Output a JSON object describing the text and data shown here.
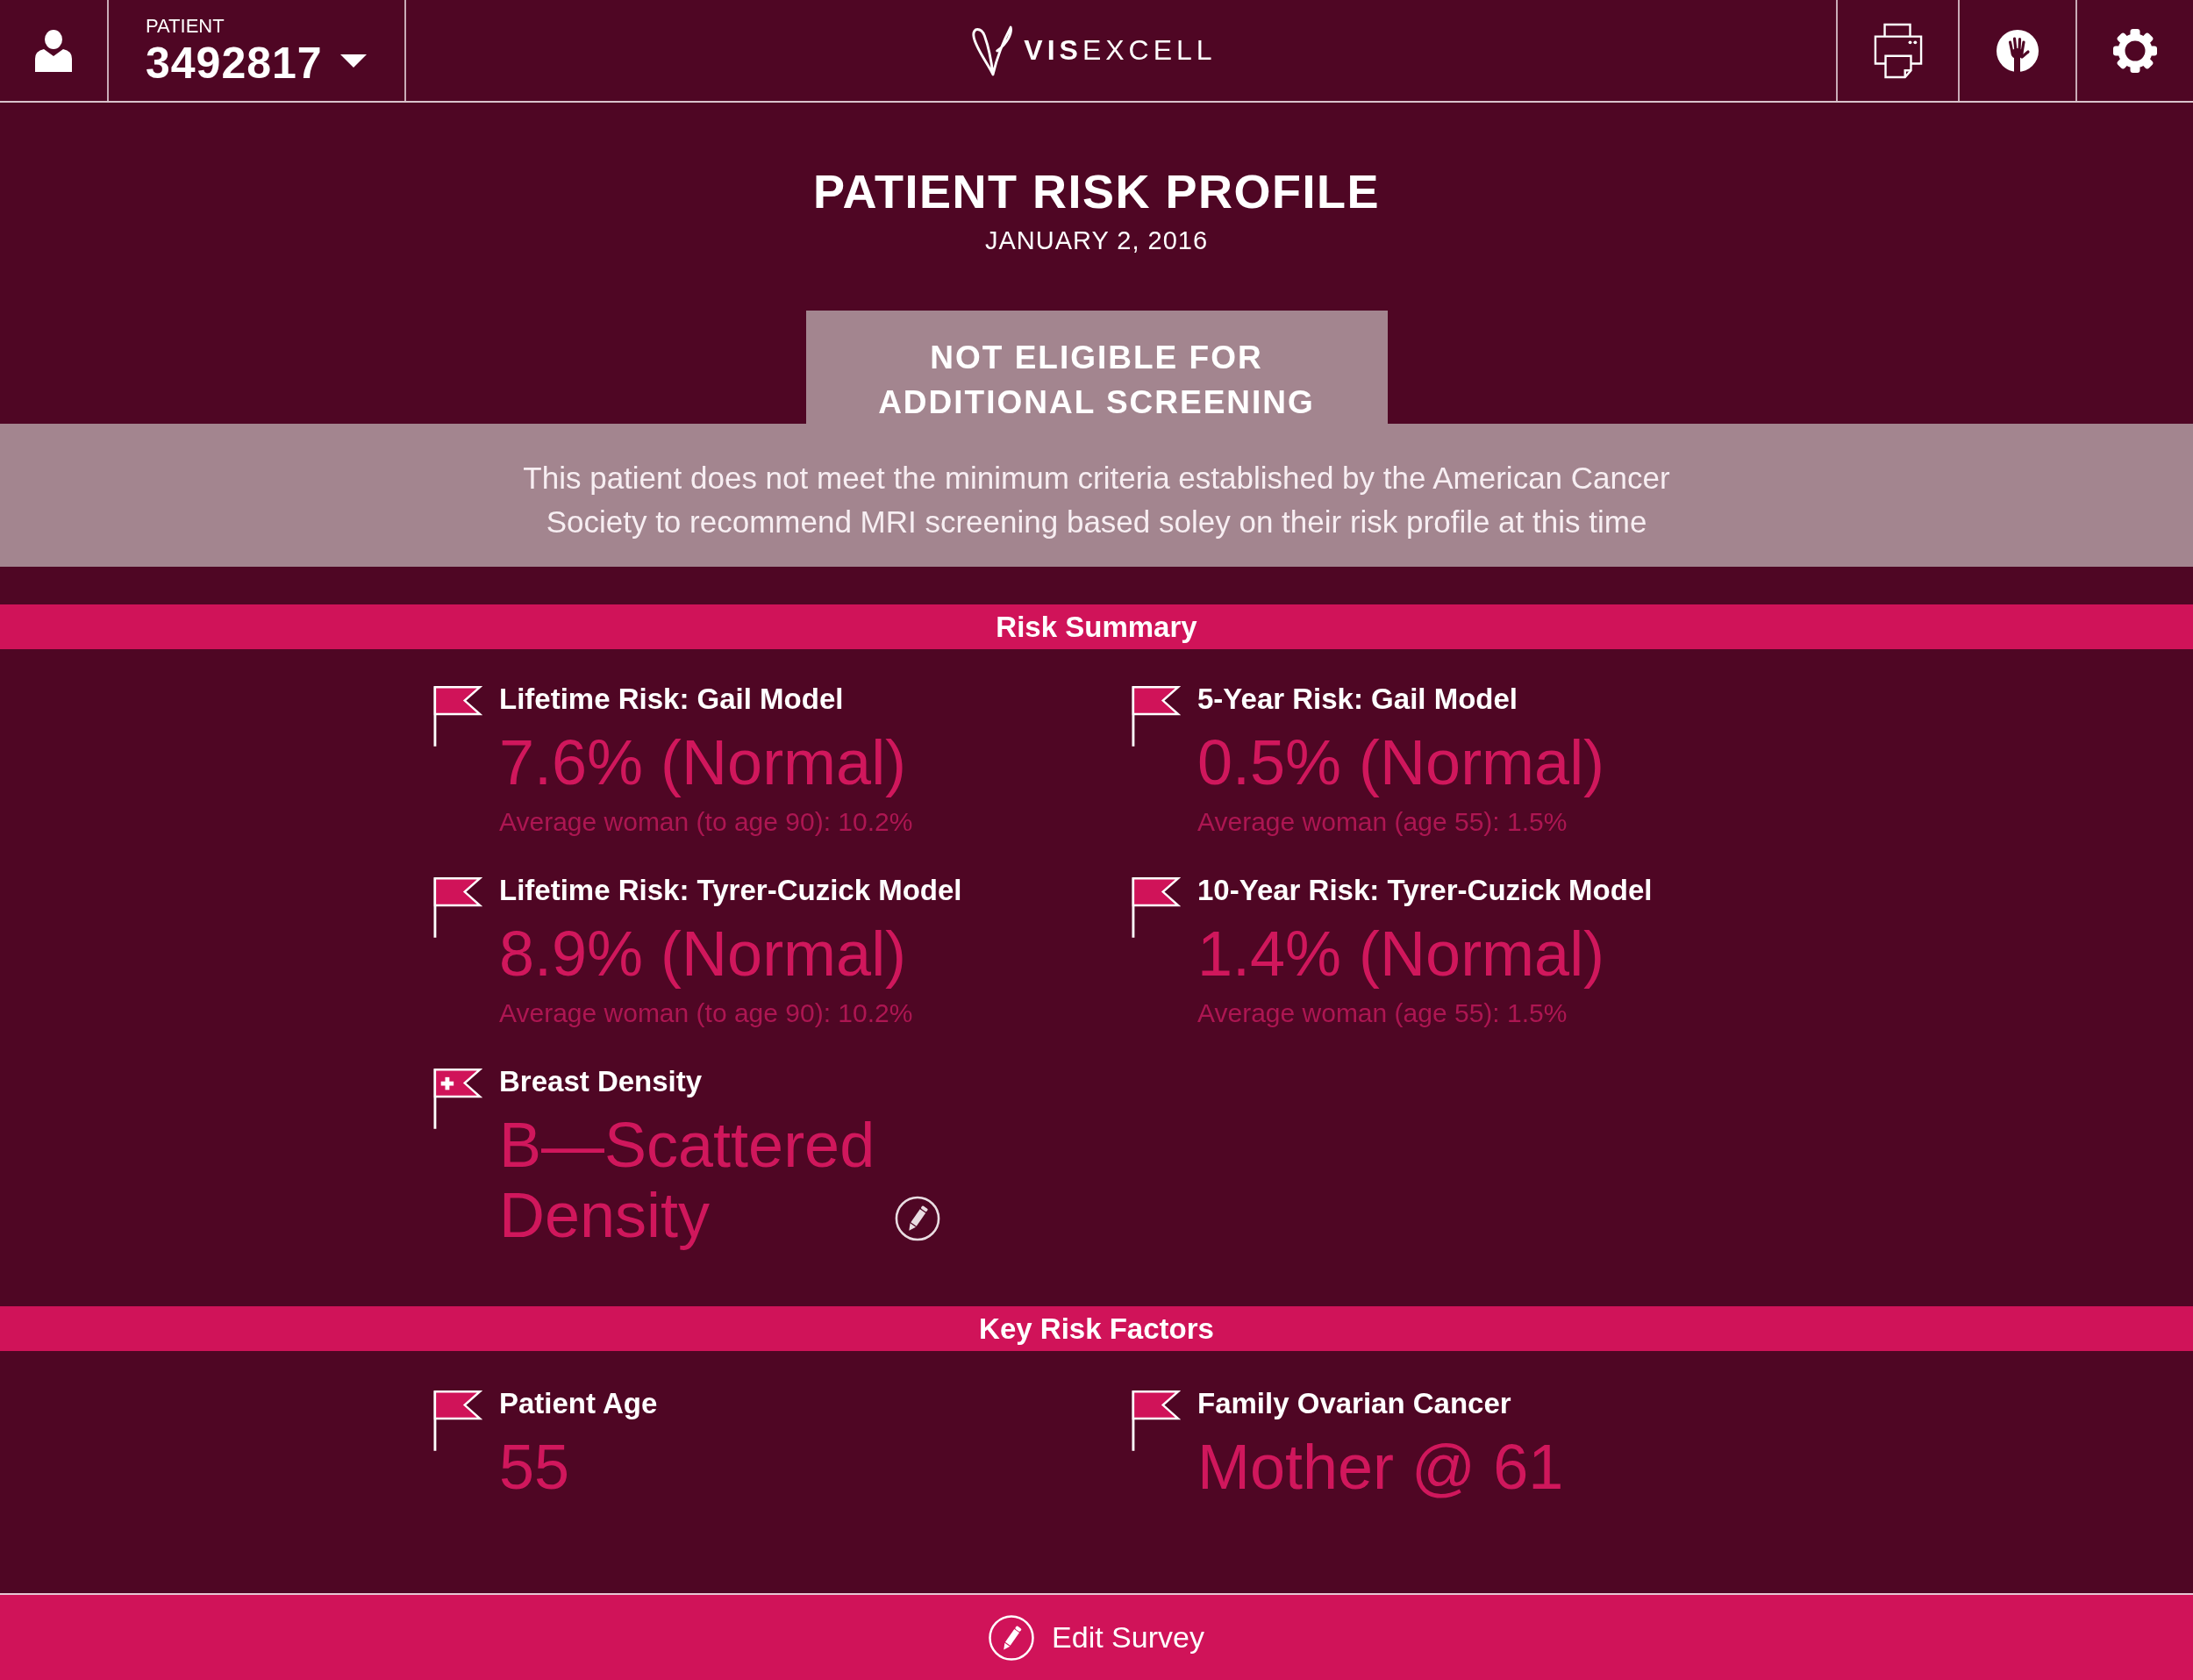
{
  "header": {
    "patient_label": "PATIENT",
    "patient_id": "3492817",
    "logo": "**VIS**EXCELL"
  },
  "report": {
    "title": "PATIENT RISK PROFILE",
    "date": "JANUARY 2, 2016"
  },
  "eligibility": {
    "status": "NOT ELIGIBLE FOR ADDITIONAL SCREENING",
    "message": "This patient does not meet the minimum criteria established by the American Cancer Society to recommend MRI screening based soley on their risk profile at this time"
  },
  "sections": [
    {
      "heading": "Risk Summary",
      "items": [
        {
          "kind": "risk",
          "label": "Lifetime Risk: Gail Model",
          "value": "7.6% (Normal)",
          "note": "Average woman (to age 90): 10.2%",
          "editable": false
        },
        {
          "kind": "risk",
          "label": "5-Year Risk: Gail Model",
          "value": "0.5% (Normal)",
          "note": "Average woman (age 55): 1.5%",
          "editable": false
        },
        {
          "kind": "risk",
          "label": "Lifetime Risk: Tyrer-Cuzick Model",
          "value": "8.9% (Normal)",
          "note": "Average woman (to age 90): 10.2%",
          "editable": false
        },
        {
          "kind": "risk",
          "label": "10-Year Risk: Tyrer-Cuzick Model",
          "value": "1.4% (Normal)",
          "note": "Average woman (age 55): 1.5%",
          "editable": false
        },
        {
          "kind": "density",
          "label": "Breast Density",
          "value": "B—Scattered Density",
          "editable": true
        }
      ]
    },
    {
      "heading": "Key Risk Factors",
      "items": [
        {
          "kind": "risk",
          "label": "Patient Age",
          "value": "55",
          "editable": false
        },
        {
          "kind": "risk",
          "label": "Family Ovarian Cancer",
          "value": "Mother @ 61",
          "editable": false
        }
      ]
    }
  ],
  "footer": {
    "button": "Edit Survey"
  }
}
